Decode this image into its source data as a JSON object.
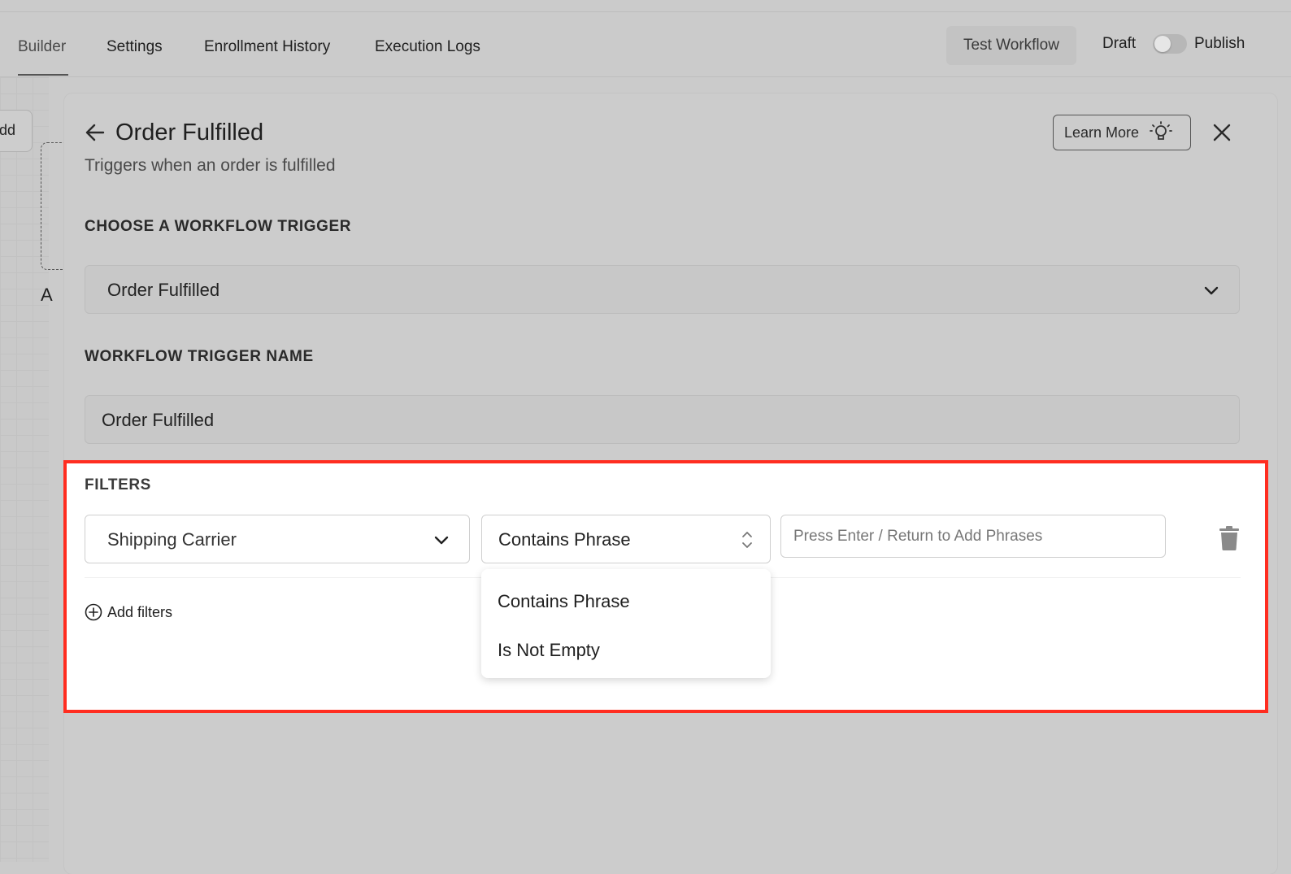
{
  "nav": {
    "tabs": [
      {
        "label": "Builder",
        "active": true
      },
      {
        "label": "Settings"
      },
      {
        "label": "Enrollment History"
      },
      {
        "label": "Execution Logs"
      }
    ],
    "test_workflow": "Test Workflow",
    "draft_label": "Draft",
    "publish_label": "Publish",
    "publish_on": false
  },
  "canvas": {
    "node_label": "dd",
    "letter": "A"
  },
  "panel": {
    "title": "Order Fulfilled",
    "subtitle": "Triggers when an order is fulfilled",
    "learn_more": "Learn More",
    "trigger_section_label": "CHOOSE A WORKFLOW TRIGGER",
    "trigger_value": "Order Fulfilled",
    "name_section_label": "WORKFLOW TRIGGER NAME",
    "name_value": "Order Fulfilled"
  },
  "filters": {
    "label": "FILTERS",
    "field_value": "Shipping Carrier",
    "operator_value": "Contains Phrase",
    "phrase_placeholder": "Press Enter / Return to Add Phrases",
    "add_filters": "Add filters",
    "operator_options": [
      "Contains Phrase",
      "Is Not Empty"
    ]
  },
  "colors": {
    "highlight_border": "#ff2d20",
    "overlay": "#cbcbcb"
  }
}
